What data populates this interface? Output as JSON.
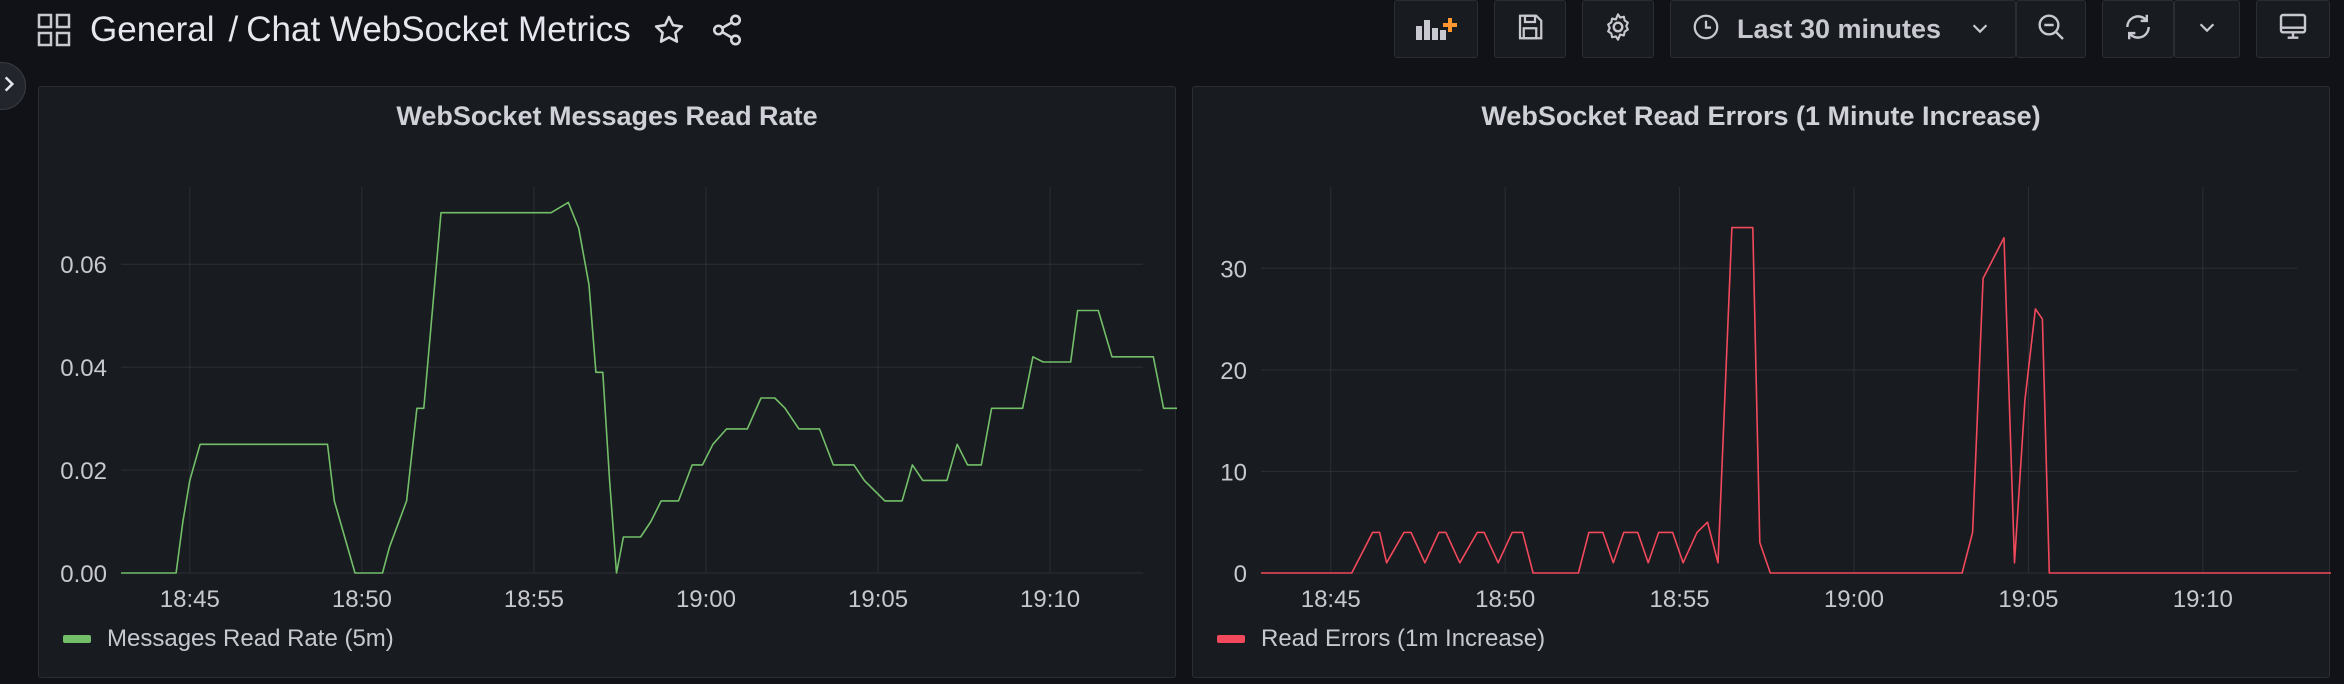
{
  "header": {
    "folder": "General",
    "separator": "/",
    "dashboard_title": "Chat WebSocket Metrics",
    "time_range": "Last 30 minutes",
    "accent_color": "#ff9830"
  },
  "panels": [
    {
      "title": "WebSocket Messages Read Rate",
      "legend": "Messages Read Rate (5m)",
      "color": "#73bf69"
    },
    {
      "title": "WebSocket Read Errors (1 Minute Increase)",
      "legend": "Read Errors (1m Increase)",
      "color": "#f2495c"
    }
  ],
  "chart_data": [
    {
      "type": "line",
      "title": "WebSocket Messages Read Rate",
      "x_ticks": [
        "18:45",
        "18:50",
        "18:55",
        "19:00",
        "19:05",
        "19:10"
      ],
      "y_ticks": [
        "0.00",
        "0.02",
        "0.04",
        "0.06"
      ],
      "ylim": [
        0,
        0.075
      ],
      "xlim": [
        "18:43",
        "19:12.7"
      ],
      "grid": true,
      "legend_position": "bottom-left",
      "series": [
        {
          "name": "Messages Read Rate (5m)",
          "color": "#73bf69",
          "x": [
            -2,
            -0.4,
            -0.2,
            0,
            0.3,
            4,
            4.2,
            4.8,
            5.6,
            5.8,
            6.3,
            6.6,
            6.8,
            7.3,
            7.6,
            10.5,
            11,
            11.3,
            11.6,
            11.8,
            12,
            12.2,
            12.4,
            12.6,
            13.1,
            13.4,
            13.7,
            14.2,
            14.6,
            14.9,
            15.2,
            15.6,
            16.2,
            16.6,
            17,
            17.3,
            17.7,
            18.3,
            18.7,
            19.3,
            19.6,
            20.2,
            20.7,
            21,
            21.3,
            22,
            22.3,
            22.6,
            23,
            23.3,
            23.7,
            24.2,
            24.5,
            24.8,
            25.6,
            25.8,
            26,
            26.4,
            26.8,
            27.2,
            27.6,
            28,
            28.3,
            28.8,
            29.2,
            29.6,
            30.2,
            31
          ],
          "y": [
            0,
            0,
            0.01,
            0.018,
            0.025,
            0.025,
            0.014,
            0,
            0,
            0.005,
            0.014,
            0.032,
            0.032,
            0.07,
            0.07,
            0.07,
            0.072,
            0.067,
            0.056,
            0.039,
            0.039,
            0.018,
            0,
            0.007,
            0.007,
            0.01,
            0.014,
            0.014,
            0.021,
            0.021,
            0.025,
            0.028,
            0.028,
            0.034,
            0.034,
            0.032,
            0.028,
            0.028,
            0.021,
            0.021,
            0.018,
            0.014,
            0.014,
            0.021,
            0.018,
            0.018,
            0.025,
            0.021,
            0.021,
            0.032,
            0.032,
            0.032,
            0.042,
            0.041,
            0.041,
            0.051,
            0.051,
            0.051,
            0.042,
            0.042,
            0.042,
            0.042,
            0.032,
            0.032,
            0.032,
            0.021,
            0.021,
            0.021
          ]
        }
      ]
    },
    {
      "type": "line",
      "title": "WebSocket Read Errors (1 Minute Increase)",
      "x_ticks": [
        "18:45",
        "18:50",
        "18:55",
        "19:00",
        "19:05",
        "19:10"
      ],
      "y_ticks": [
        "0",
        "10",
        "20",
        "30"
      ],
      "ylim": [
        0,
        38
      ],
      "xlim": [
        "18:43",
        "19:12.7"
      ],
      "grid": true,
      "legend_position": "bottom-left",
      "series": [
        {
          "name": "Read Errors (1m Increase)",
          "color": "#f2495c",
          "x": [
            -2,
            0.6,
            0.9,
            1.2,
            1.4,
            1.6,
            2.1,
            2.3,
            2.7,
            3.1,
            3.3,
            3.7,
            4.2,
            4.4,
            4.8,
            5.2,
            5.5,
            5.8,
            7.1,
            7.4,
            7.8,
            8.1,
            8.4,
            8.8,
            9.1,
            9.4,
            9.8,
            10.1,
            10.5,
            10.8,
            11.1,
            11.5,
            11.6,
            11.8,
            12.1,
            12.3,
            12.6,
            13.0,
            13.4,
            18.1,
            18.4,
            18.7,
            19.0,
            19.3,
            19.6,
            19.9,
            20.2,
            20.4,
            20.6,
            20.9,
            28.7,
            29.2
          ],
          "y": [
            0,
            0,
            2,
            4,
            4,
            1,
            4,
            4,
            1,
            4,
            4,
            1,
            4,
            4,
            1,
            4,
            4,
            0,
            0,
            4,
            4,
            1,
            4,
            4,
            1,
            4,
            4,
            1,
            4,
            5,
            1,
            34,
            34,
            34,
            34,
            3,
            0,
            0,
            0,
            0,
            4,
            29,
            31,
            33,
            1,
            17,
            26,
            25,
            0,
            0,
            0,
            25
          ]
        }
      ]
    }
  ]
}
